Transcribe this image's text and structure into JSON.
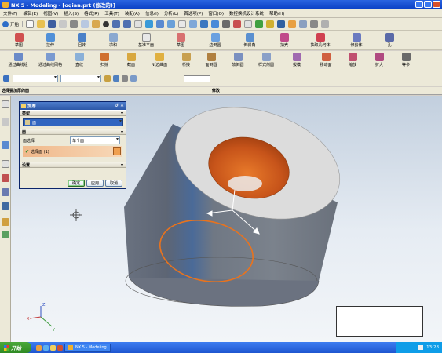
{
  "window": {
    "title": "NX 5 - Modeling - [oqian.prt (修改的)]"
  },
  "menu": [
    "文件(F)",
    "编辑(E)",
    "视图(V)",
    "插入(S)",
    "格式(R)",
    "工具(T)",
    "装配(A)",
    "信息(I)",
    "分析(L)",
    "首选项(P)",
    "窗口(O)",
    "数控换机设计系统",
    "帮助(H)"
  ],
  "toolbar": {
    "start_label": "开始"
  },
  "ribbon1": [
    "草图",
    "拉伸",
    "回转",
    "求和",
    "基准平面",
    "草图",
    "边倒圆",
    "倒斜角",
    "抽壳",
    "抽取几何体",
    "修剪体",
    "孔"
  ],
  "ribbon2": [
    "通过曲线组",
    "通过曲线网格",
    "直纹",
    "扫掠",
    "截面",
    "N 边曲面",
    "桥接",
    "面倒圆",
    "软倒圆",
    "样式倒圆",
    "拔模",
    "移动面",
    "缩放",
    "扩大",
    "等参"
  ],
  "selection": {
    "label": "选择要加厚的面",
    "hint": "修改"
  },
  "status": {
    "left": "选择要加厚的面",
    "center": "修改"
  },
  "dialog": {
    "title": "加厚",
    "type_group": "类型",
    "type_value": "面",
    "face_group": "面",
    "face_select_label": "面选择",
    "face_select_value": "单个面",
    "selected_faces": "选择面 (1)",
    "settings_group": "设置",
    "ok": "确定",
    "apply": "应用",
    "cancel": "取消"
  },
  "axes": {
    "x": "X",
    "y": "Y",
    "z": "Z"
  },
  "taskbar": {
    "start": "开始",
    "task": "NX 5 - Modeling",
    "time": "13:28"
  },
  "colors": {
    "body": "#6f7784",
    "hole": "#d9621e",
    "titlebar": "#0a3fc4"
  }
}
